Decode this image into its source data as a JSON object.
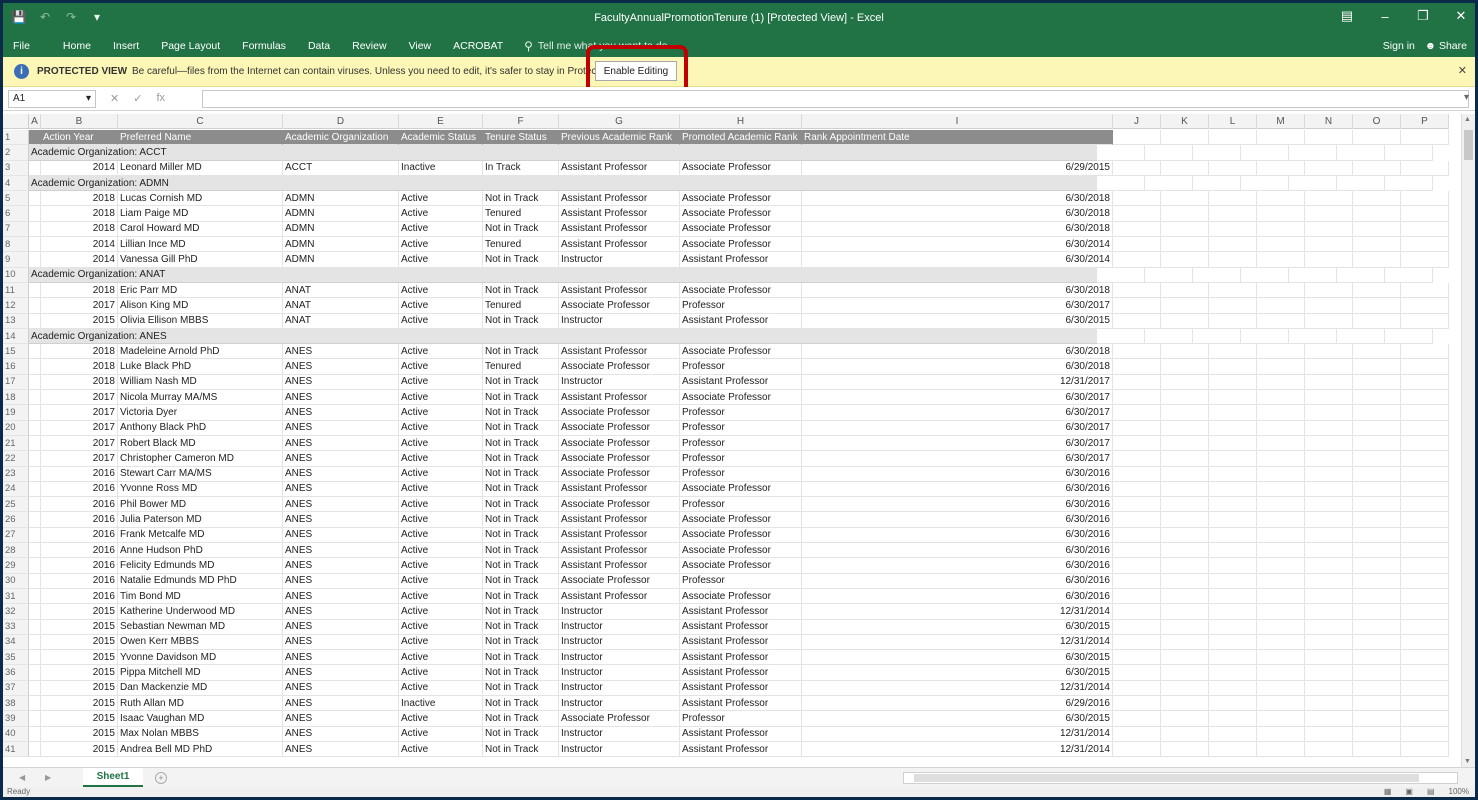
{
  "app": {
    "title": "FacultyAnnualPromotionTenure (1)  [Protected View] - Excel",
    "qat_icons": [
      "save-icon",
      "undo-icon",
      "redo-icon",
      "customize-icon"
    ],
    "sign_in": "Sign in",
    "share": "Share"
  },
  "ribbon": {
    "tabs": [
      "File",
      "Home",
      "Insert",
      "Page Layout",
      "Formulas",
      "Data",
      "Review",
      "View",
      "ACROBAT"
    ],
    "tell_me": "Tell me what you want to do"
  },
  "protected_view": {
    "title": "PROTECTED VIEW",
    "message": "Be careful—files from the Internet can contain viruses. Unless you need to edit, it's safer to stay in Protected View.",
    "enable_button": "Enable Editing"
  },
  "formula_bar": {
    "name_box": "A1",
    "fx": "fx",
    "value": ""
  },
  "grid": {
    "columns": [
      "A",
      "B",
      "C",
      "D",
      "E",
      "F",
      "G",
      "H",
      "I",
      "J",
      "K",
      "L",
      "M",
      "N",
      "O",
      "P"
    ],
    "headers": [
      "Action Year",
      "Preferred Name",
      "Academic Organization",
      "Academic Status",
      "Tenure Status",
      "Previous Academic Rank",
      "Promoted Academic Rank",
      "Rank Appointment Date"
    ],
    "rows": [
      {
        "n": "2",
        "group": "Academic Organization: ACCT"
      },
      {
        "n": "3",
        "cells": [
          "2014",
          "Leonard Miller MD",
          "ACCT",
          "Inactive",
          "In Track",
          "Assistant Professor",
          "Associate Professor",
          "6/29/2015"
        ]
      },
      {
        "n": "4",
        "group": "Academic Organization: ADMN"
      },
      {
        "n": "5",
        "cells": [
          "2018",
          "Lucas Cornish MD",
          "ADMN",
          "Active",
          "Not in Track",
          "Assistant Professor",
          "Associate Professor",
          "6/30/2018"
        ]
      },
      {
        "n": "6",
        "cells": [
          "2018",
          "Liam Paige MD",
          "ADMN",
          "Active",
          "Tenured",
          "Assistant Professor",
          "Associate Professor",
          "6/30/2018"
        ]
      },
      {
        "n": "7",
        "cells": [
          "2018",
          "Carol Howard MD",
          "ADMN",
          "Active",
          "Not in Track",
          "Assistant Professor",
          "Associate Professor",
          "6/30/2018"
        ]
      },
      {
        "n": "8",
        "cells": [
          "2014",
          "Lillian Ince MD",
          "ADMN",
          "Active",
          "Tenured",
          "Assistant Professor",
          "Associate Professor",
          "6/30/2014"
        ]
      },
      {
        "n": "9",
        "cells": [
          "2014",
          "Vanessa Gill PhD",
          "ADMN",
          "Active",
          "Not in Track",
          "Instructor",
          "Assistant Professor",
          "6/30/2014"
        ]
      },
      {
        "n": "10",
        "group": "Academic Organization: ANAT"
      },
      {
        "n": "11",
        "cells": [
          "2018",
          "Eric Parr MD",
          "ANAT",
          "Active",
          "Not in Track",
          "Assistant Professor",
          "Associate Professor",
          "6/30/2018"
        ]
      },
      {
        "n": "12",
        "cells": [
          "2017",
          "Alison King MD",
          "ANAT",
          "Active",
          "Tenured",
          "Associate Professor",
          "Professor",
          "6/30/2017"
        ]
      },
      {
        "n": "13",
        "cells": [
          "2015",
          "Olivia Ellison MBBS",
          "ANAT",
          "Active",
          "Not in Track",
          "Instructor",
          "Assistant Professor",
          "6/30/2015"
        ]
      },
      {
        "n": "14",
        "group": "Academic Organization: ANES"
      },
      {
        "n": "15",
        "cells": [
          "2018",
          "Madeleine Arnold PhD",
          "ANES",
          "Active",
          "Not in Track",
          "Assistant Professor",
          "Associate Professor",
          "6/30/2018"
        ]
      },
      {
        "n": "16",
        "cells": [
          "2018",
          "Luke Black PhD",
          "ANES",
          "Active",
          "Tenured",
          "Associate Professor",
          "Professor",
          "6/30/2018"
        ]
      },
      {
        "n": "17",
        "cells": [
          "2018",
          "William Nash MD",
          "ANES",
          "Active",
          "Not in Track",
          "Instructor",
          "Assistant Professor",
          "12/31/2017"
        ]
      },
      {
        "n": "18",
        "cells": [
          "2017",
          "Nicola Murray MA/MS",
          "ANES",
          "Active",
          "Not in Track",
          "Assistant Professor",
          "Associate Professor",
          "6/30/2017"
        ]
      },
      {
        "n": "19",
        "cells": [
          "2017",
          "Victoria Dyer",
          "ANES",
          "Active",
          "Not in Track",
          "Associate Professor",
          "Professor",
          "6/30/2017"
        ]
      },
      {
        "n": "20",
        "cells": [
          "2017",
          "Anthony Black PhD",
          "ANES",
          "Active",
          "Not in Track",
          "Associate Professor",
          "Professor",
          "6/30/2017"
        ]
      },
      {
        "n": "21",
        "cells": [
          "2017",
          "Robert Black MD",
          "ANES",
          "Active",
          "Not in Track",
          "Associate Professor",
          "Professor",
          "6/30/2017"
        ]
      },
      {
        "n": "22",
        "cells": [
          "2017",
          "Christopher Cameron MD",
          "ANES",
          "Active",
          "Not in Track",
          "Associate Professor",
          "Professor",
          "6/30/2017"
        ]
      },
      {
        "n": "23",
        "cells": [
          "2016",
          "Stewart Carr MA/MS",
          "ANES",
          "Active",
          "Not in Track",
          "Associate Professor",
          "Professor",
          "6/30/2016"
        ]
      },
      {
        "n": "24",
        "cells": [
          "2016",
          "Yvonne Ross MD",
          "ANES",
          "Active",
          "Not in Track",
          "Assistant Professor",
          "Associate Professor",
          "6/30/2016"
        ]
      },
      {
        "n": "25",
        "cells": [
          "2016",
          "Phil Bower MD",
          "ANES",
          "Active",
          "Not in Track",
          "Associate Professor",
          "Professor",
          "6/30/2016"
        ]
      },
      {
        "n": "26",
        "cells": [
          "2016",
          "Julia Paterson MD",
          "ANES",
          "Active",
          "Not in Track",
          "Assistant Professor",
          "Associate Professor",
          "6/30/2016"
        ]
      },
      {
        "n": "27",
        "cells": [
          "2016",
          "Frank Metcalfe MD",
          "ANES",
          "Active",
          "Not in Track",
          "Assistant Professor",
          "Associate Professor",
          "6/30/2016"
        ]
      },
      {
        "n": "28",
        "cells": [
          "2016",
          "Anne Hudson PhD",
          "ANES",
          "Active",
          "Not in Track",
          "Assistant Professor",
          "Associate Professor",
          "6/30/2016"
        ]
      },
      {
        "n": "29",
        "cells": [
          "2016",
          "Felicity Edmunds MD",
          "ANES",
          "Active",
          "Not in Track",
          "Assistant Professor",
          "Associate Professor",
          "6/30/2016"
        ]
      },
      {
        "n": "30",
        "cells": [
          "2016",
          "Natalie Edmunds MD PhD",
          "ANES",
          "Active",
          "Not in Track",
          "Associate Professor",
          "Professor",
          "6/30/2016"
        ]
      },
      {
        "n": "31",
        "cells": [
          "2016",
          "Tim Bond MD",
          "ANES",
          "Active",
          "Not in Track",
          "Assistant Professor",
          "Associate Professor",
          "6/30/2016"
        ]
      },
      {
        "n": "32",
        "cells": [
          "2015",
          "Katherine Underwood MD",
          "ANES",
          "Active",
          "Not in Track",
          "Instructor",
          "Assistant Professor",
          "12/31/2014"
        ]
      },
      {
        "n": "33",
        "cells": [
          "2015",
          "Sebastian Newman MD",
          "ANES",
          "Active",
          "Not in Track",
          "Instructor",
          "Assistant Professor",
          "6/30/2015"
        ]
      },
      {
        "n": "34",
        "cells": [
          "2015",
          "Owen Kerr MBBS",
          "ANES",
          "Active",
          "Not in Track",
          "Instructor",
          "Assistant Professor",
          "12/31/2014"
        ]
      },
      {
        "n": "35",
        "cells": [
          "2015",
          "Yvonne Davidson MD",
          "ANES",
          "Active",
          "Not in Track",
          "Instructor",
          "Assistant Professor",
          "6/30/2015"
        ]
      },
      {
        "n": "36",
        "cells": [
          "2015",
          "Pippa Mitchell MD",
          "ANES",
          "Active",
          "Not in Track",
          "Instructor",
          "Assistant Professor",
          "6/30/2015"
        ]
      },
      {
        "n": "37",
        "cells": [
          "2015",
          "Dan Mackenzie MD",
          "ANES",
          "Active",
          "Not in Track",
          "Instructor",
          "Assistant Professor",
          "12/31/2014"
        ]
      },
      {
        "n": "38",
        "cells": [
          "2015",
          "Ruth Allan MD",
          "ANES",
          "Inactive",
          "Not in Track",
          "Instructor",
          "Assistant Professor",
          "6/29/2016"
        ]
      },
      {
        "n": "39",
        "cells": [
          "2015",
          "Isaac Vaughan MD",
          "ANES",
          "Active",
          "Not in Track",
          "Associate Professor",
          "Professor",
          "6/30/2015"
        ]
      },
      {
        "n": "40",
        "cells": [
          "2015",
          "Max Nolan MBBS",
          "ANES",
          "Active",
          "Not in Track",
          "Instructor",
          "Assistant Professor",
          "12/31/2014"
        ]
      },
      {
        "n": "41",
        "cells": [
          "2015",
          "Andrea Bell MD PhD",
          "ANES",
          "Active",
          "Not in Track",
          "Instructor",
          "Assistant Professor",
          "12/31/2014"
        ]
      }
    ]
  },
  "sheets": {
    "active": "Sheet1"
  },
  "status": {
    "ready": "Ready",
    "zoom": "100%"
  },
  "colors": {
    "excel_green": "#217346",
    "header_gray": "#8c8c8c",
    "warning_yellow": "#fcf7b6",
    "highlight_red": "#c00000"
  }
}
